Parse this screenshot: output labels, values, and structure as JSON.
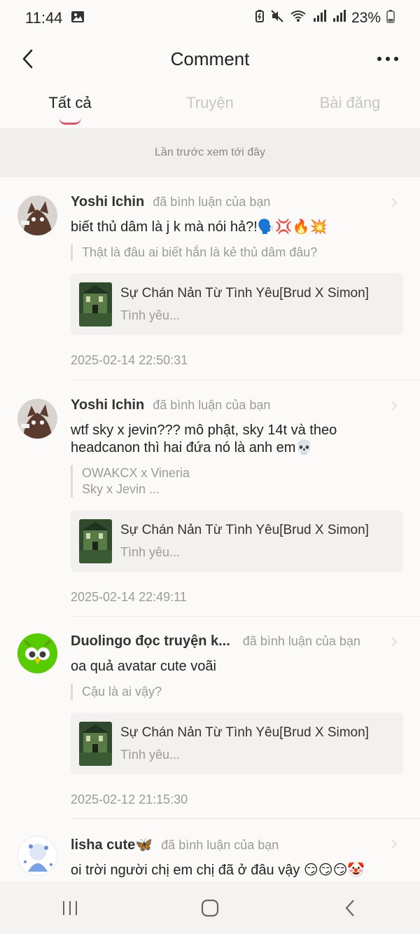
{
  "status": {
    "time": "11:44",
    "battery": "23%"
  },
  "header": {
    "title": "Comment"
  },
  "tabs": [
    {
      "label": "Tất cả"
    },
    {
      "label": "Truyện"
    },
    {
      "label": "Bài đăng"
    }
  ],
  "banner": "Lần trước xem tới đây",
  "comments": [
    {
      "user": "Yoshi Ichin",
      "action": "đã bình luận của bạn",
      "text": "biết thủ dâm là j k mà nói hả?!🗣️💢🔥💥",
      "quote": "Thật là đâu ai biết hắn là kẻ thủ dâm đâu?",
      "story_title": "Sự Chán Nản Từ Tình Yêu[Brud X Simon]",
      "story_sub": "Tình yêu...",
      "timestamp": "2025-02-14 22:50:31"
    },
    {
      "user": "Yoshi Ichin",
      "action": "đã bình luận của bạn",
      "text": "wtf sky x jevin??? mô phật, sky 14t và theo headcanon thì hai đứa nó là anh em💀",
      "quote_line1": "OWAKCX x Vineria",
      "quote_line2": "Sky x Jevin ...",
      "story_title": "Sự Chán Nản Từ Tình Yêu[Brud X Simon]",
      "story_sub": "Tình yêu...",
      "timestamp": "2025-02-14 22:49:11"
    },
    {
      "user": "Duolingo đọc truyện k...",
      "action": "đã bình luận của bạn",
      "text": "oa quả avatar cute voãi",
      "quote": "Cậu là ai vậy?",
      "story_title": "Sự Chán Nản Từ Tình Yêu[Brud X Simon]",
      "story_sub": "Tình yêu...",
      "timestamp": "2025-02-12 21:15:30"
    },
    {
      "user": "lisha cute🦋",
      "action": "đã bình luận của bạn",
      "text": "oi trời người chị em chị đã ở đâu vậy 😏😏😏🤡"
    }
  ],
  "colors": {
    "accent": "#ee4d6a",
    "duolingo": "#58cc02"
  }
}
